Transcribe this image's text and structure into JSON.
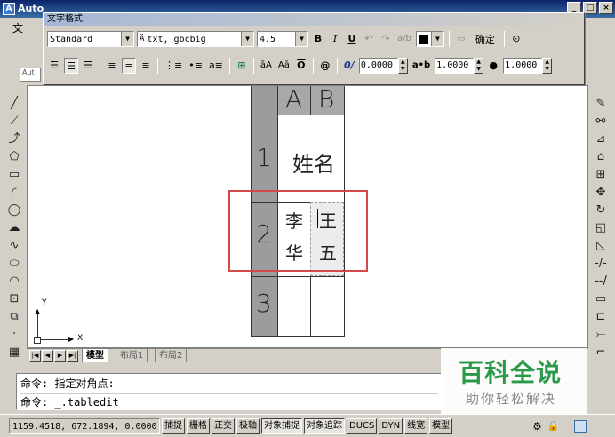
{
  "window": {
    "title": "Auto",
    "app_icon_label": "A"
  },
  "menu": {
    "first_item": "文"
  },
  "text_format": {
    "title": "文字格式",
    "style": "Standard",
    "font": "txt, gbcbig",
    "height": "4.5",
    "bold": "B",
    "italic": "I",
    "underline": "U",
    "ok_label": "确定",
    "oblique": "0.0000",
    "tracking": "1.0000",
    "width_factor": "1.0000",
    "color_hex": "#000000"
  },
  "table": {
    "header_cols": [
      "A",
      "B"
    ],
    "row_numbers": [
      "1",
      "2",
      "3"
    ],
    "cells": {
      "r1_merged": "姓名",
      "r2_a_line1": "李",
      "r2_a_line2": "华",
      "r2_b_line1": "王",
      "r2_b_line2": "五"
    },
    "selection_color": "#d24a4a"
  },
  "ucs": {
    "x_label": "X",
    "y_label": "Y"
  },
  "layout_tabs": [
    "模型",
    "布局1",
    "布局2"
  ],
  "command": {
    "line1": "命令: 指定对角点:",
    "line2": "命令: _.tabledit"
  },
  "status": {
    "coords": "1159.4518, 672.1894, 0.0000",
    "buttons": [
      "捕捉",
      "栅格",
      "正交",
      "极轴",
      "对象捕捉",
      "对象追踪",
      "DUCS",
      "DYN",
      "线宽",
      "模型"
    ]
  },
  "watermark": {
    "brand": "百科全说",
    "slogan": "助你轻松解决",
    "color": "#2a9a4a"
  },
  "toolstrip_tab": "Aut"
}
